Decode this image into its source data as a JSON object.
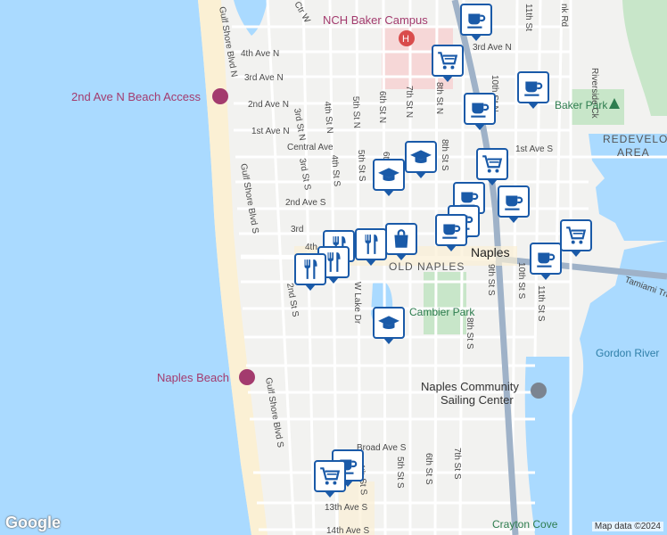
{
  "map": {
    "labels": {
      "nch": "NCH Baker Campus",
      "beach_access": "2nd Ave N Beach Access",
      "naples_beach": "Naples Beach",
      "baker_park": "Baker Park",
      "redevelop1": "REDEVELO",
      "redevelop2": "AREA",
      "naples": "Naples",
      "old_naples": "OLD NAPLES",
      "cambier": "Cambier Park",
      "sailing1": "Naples Community",
      "sailing2": "Sailing Center",
      "gordon": "Gordon River",
      "crayton": "Crayton Cove",
      "tamiami": "Tamiami Trl",
      "riverside": "Riverside Ck",
      "gulf1": "Gulf Shore Blvd N",
      "gulf2": "Gulf Shore Blvd S",
      "gulf3": "Gulf Shore Blvd S",
      "ave_4n": "4th Ave N",
      "ave_3n": "3rd Ave N",
      "ave_2n": "2nd Ave N",
      "ave_1n": "1st Ave N",
      "central": "Central Ave",
      "ave_1s": "1st Ave S",
      "ave_2s": "2nd Ave S",
      "ave_3s": "3rd",
      "ave_3n_e": "3rd Ave N",
      "broad": "Broad Ave S",
      "ave_13s": "13th Ave S",
      "ave_14s": "14th Ave S",
      "st_2s": "2nd St S",
      "st_3n": "3rd St N",
      "st_3s": "3rd St S",
      "st_4n": "4th St N",
      "st_4s": "4th St S",
      "st_4s_b": "4th St S",
      "st_5n": "5th St N",
      "st_5s": "5th St S",
      "st_5s_b": "5th St S",
      "st_6n": "6th St N",
      "st_6s_b": "6th St S",
      "st_7n": "7th St N",
      "st_7s_b": "7th St S",
      "st_8n": "8th St N",
      "st_8s": "8th St S",
      "st_8s_b": "8th St S",
      "st_9s": "9th St S",
      "st_10n": "10th St N",
      "st_10s": "10th St S",
      "st_11n": "11th St",
      "st_11s": "11th St S",
      "lake": "W Lake Dr",
      "bank": "nk Rd",
      "ctw": "Ctr W",
      "sixth": "6th",
      "four_top": "4th"
    },
    "markers": [
      {
        "type": "cafe",
        "name": "cafe-marker"
      },
      {
        "type": "grocery",
        "name": "grocery-marker"
      },
      {
        "type": "cafe",
        "name": "cafe-marker"
      },
      {
        "type": "cafe",
        "name": "cafe-marker"
      },
      {
        "type": "school",
        "name": "school-marker"
      },
      {
        "type": "school",
        "name": "school-marker"
      },
      {
        "type": "grocery",
        "name": "grocery-marker"
      },
      {
        "type": "cafe",
        "name": "cafe-marker"
      },
      {
        "type": "cafe",
        "name": "cafe-marker"
      },
      {
        "type": "cafe",
        "name": "cafe-marker"
      },
      {
        "type": "cafe",
        "name": "cafe-marker"
      },
      {
        "type": "grocery",
        "name": "grocery-marker"
      },
      {
        "type": "cafe",
        "name": "cafe-marker"
      },
      {
        "type": "shopping",
        "name": "shopping-marker"
      },
      {
        "type": "restaurant",
        "name": "restaurant-marker"
      },
      {
        "type": "restaurant",
        "name": "restaurant-marker"
      },
      {
        "type": "restaurant",
        "name": "restaurant-marker"
      },
      {
        "type": "restaurant",
        "name": "restaurant-marker"
      },
      {
        "type": "school",
        "name": "school-marker"
      },
      {
        "type": "cafe",
        "name": "cafe-marker"
      },
      {
        "type": "grocery",
        "name": "grocery-marker"
      }
    ]
  },
  "footer": {
    "logo": "Google",
    "attribution": "Map data ©2024"
  },
  "colors": {
    "water": "#aadaff",
    "land": "#f2f2f0",
    "beach": "#fbf0d4",
    "park": "#c8e6c9",
    "hospital": "#f6d7d7",
    "marker_border": "#1a5aa8",
    "highway": "#9fb2c8"
  }
}
